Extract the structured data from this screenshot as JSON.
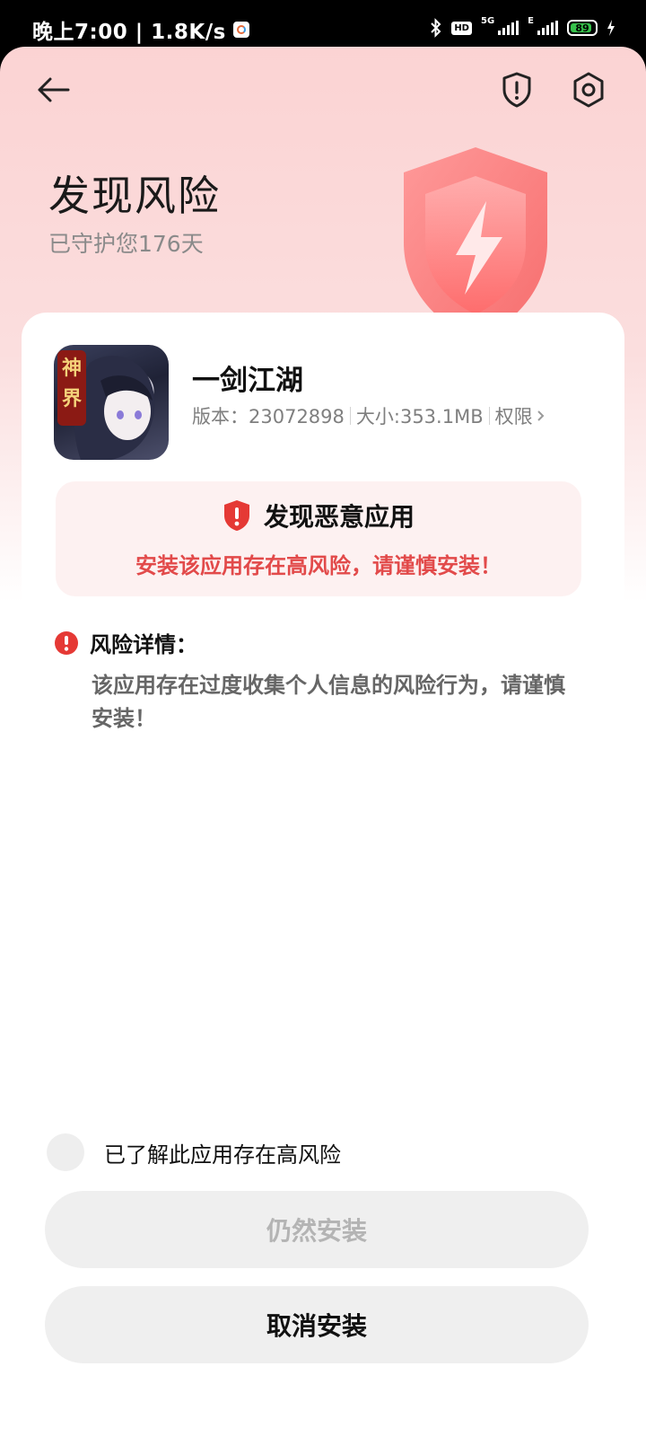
{
  "status_bar": {
    "time_speed": "晚上7:00 | 1.8K/s",
    "hd_badge": "HD",
    "net_5g": "5G",
    "net_e": "E",
    "battery_level": "89",
    "battery_percent": 89
  },
  "header": {
    "title": "发现风险",
    "subtitle": "已守护您176天",
    "icons": [
      "back-arrow-icon",
      "shield-alert-icon",
      "settings-gear-icon"
    ]
  },
  "app": {
    "name": "一剑江湖",
    "version_label": "版本：23072898",
    "size_label": "大小:353.1MB",
    "permission_label": "权限",
    "icon_badge": "神界"
  },
  "warning": {
    "title": "发现恶意应用",
    "description": "安装该应用存在高风险，请谨慎安装！"
  },
  "risk_detail": {
    "title": "风险详情：",
    "text": "该应用存在过度收集个人信息的风险行为，请谨慎安装！"
  },
  "acknowledge": {
    "label": "已了解此应用存在高风险",
    "checked": false
  },
  "buttons": {
    "install_anyway": "仍然安装",
    "cancel_install": "取消安装"
  },
  "colors": {
    "danger": "#e24a4a",
    "muted_text": "#8a8a8a",
    "button_bg": "#efefef"
  }
}
